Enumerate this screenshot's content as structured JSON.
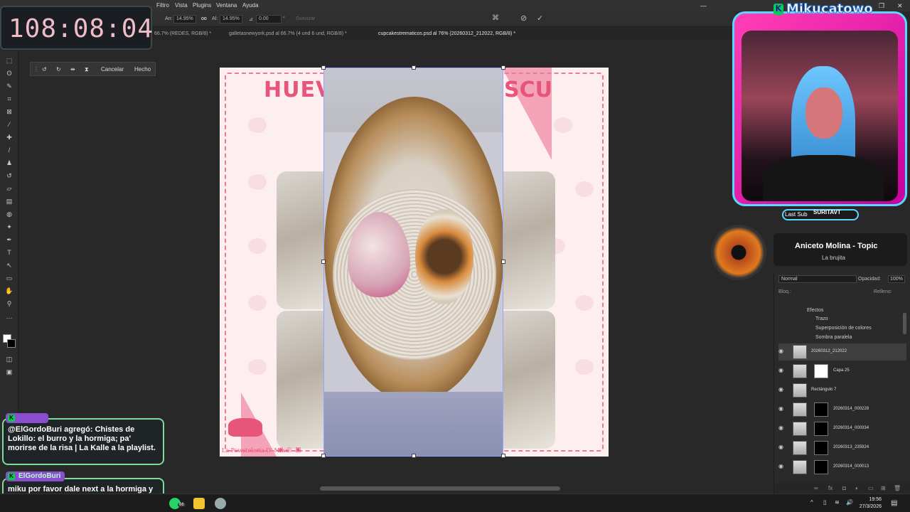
{
  "timer": "108:08:04",
  "menu": [
    "Filtro",
    "Vista",
    "Plugins",
    "Ventana",
    "Ayuda"
  ],
  "options": {
    "w_label": "An:",
    "w_value": "14.95%",
    "link": "oo",
    "h_label": "Al:",
    "h_value": "14.95%",
    "angle_value": "0.00",
    "deg": "°",
    "smooth": "Suavizar"
  },
  "tabs": [
    "66.7% (REDES, RGB/8) *",
    "galletasnewyork.psd al 66.7% (4 und   6 und, RGB/8) *",
    "cupcakestrematicos.psd al 76% (20260312_212022, RGB/8) *"
  ],
  "transform": {
    "cancel": "Cancelar",
    "done": "Hecho"
  },
  "canvas": {
    "title_left": "HUEV",
    "title_right": "SCU",
    "logo_text": "La Pawstelería D' Miku"
  },
  "stream": {
    "channel": "Mikucatowo",
    "last_sub_label": "Last Sub",
    "last_sub_user": "SURITAVT",
    "song": "Aniceto Molina - Topic",
    "artist": "La brujita"
  },
  "chat": [
    {
      "user": "",
      "message": "@ElGordoBuri agregó: Chistes de Lokillo: el burro y la hormiga; pa' morirse de la risa | La Kalle a la playlist."
    },
    {
      "user": "ElGordoBuri",
      "message": "miku por favor dale next a la hormiga y el burro de lokillo, esa no era"
    }
  ],
  "layers_panel": {
    "blend_mode": "Normal",
    "opacity_label": "Opacidad:",
    "opacity_value": "100%",
    "lock_label": "Bloq.:",
    "fill_label": "Relleno:",
    "fill_value": "100%",
    "effects": [
      "Efectos",
      "Trazo",
      "Superposición de colores",
      "Sombra paralela"
    ],
    "layers": [
      {
        "name": "20260312_212022",
        "mask": "none",
        "selected": true
      },
      {
        "name": "Capa 25",
        "mask": "white",
        "selected": false
      },
      {
        "name": "Rectángulo 7",
        "mask": "none",
        "selected": false
      },
      {
        "name": "20260314_000228",
        "mask": "black",
        "selected": false
      },
      {
        "name": "20260314_000334",
        "mask": "black",
        "selected": false
      },
      {
        "name": "20260313_235924",
        "mask": "white",
        "selected": false
      },
      {
        "name": "20260314_000013",
        "mask": "white",
        "selected": false
      }
    ]
  },
  "taskbar": {
    "time": "19:56",
    "date": "27/3/2026",
    "badge": "66"
  }
}
